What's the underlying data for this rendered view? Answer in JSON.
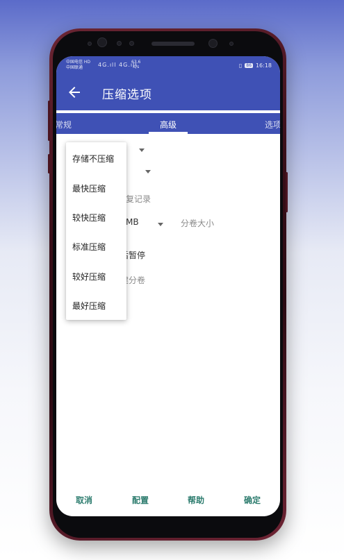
{
  "status_bar": {
    "carrier_1": "中国电信 HD",
    "carrier_2": "中国联通",
    "signal": "4G.ıll 4G.ıll",
    "speed_value": "63.6",
    "speed_unit": "K/s",
    "battery": "86",
    "time": "16:18"
  },
  "app_bar": {
    "title": "压缩选项",
    "back_icon": "arrow-left-icon"
  },
  "tabs": [
    {
      "label": "常规",
      "selected": false
    },
    {
      "label": "高级",
      "selected": true
    },
    {
      "label": "选项",
      "selected": false
    }
  ],
  "background_fields": {
    "record_text": "复记录",
    "volume_unit": "MB",
    "volume_label": "分卷大小",
    "pause_text": "后暂停",
    "split_text": "建分卷"
  },
  "compression_menu": {
    "options": [
      "存储不压缩",
      "最快压缩",
      "较快压缩",
      "标准压缩",
      "较好压缩",
      "最好压缩"
    ]
  },
  "buttons": {
    "cancel": "取消",
    "config": "配置",
    "help": "帮助",
    "ok": "确定"
  },
  "colors": {
    "primary": "#3f51b5",
    "button_text": "#2e7d6f",
    "phone_frame": "#5a1a28"
  }
}
